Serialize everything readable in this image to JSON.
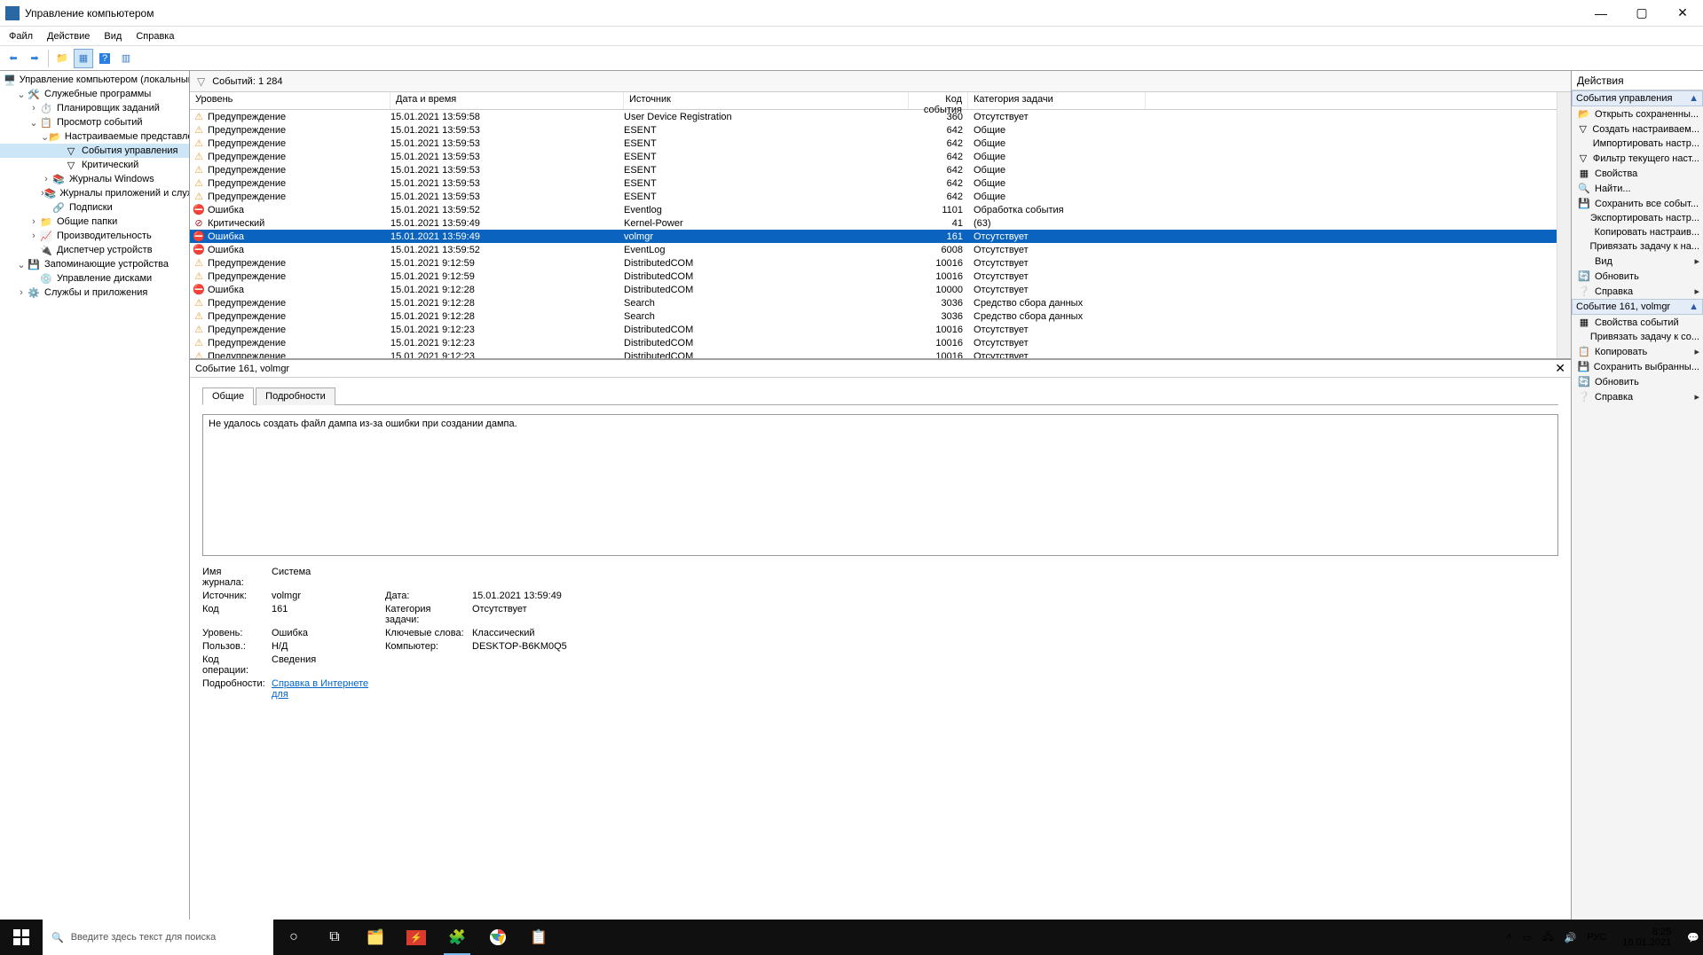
{
  "window": {
    "title": "Управление компьютером"
  },
  "menu": [
    "Файл",
    "Действие",
    "Вид",
    "Справка"
  ],
  "tree": [
    {
      "d": 0,
      "tw": "",
      "icon": "pc",
      "label": "Управление компьютером (локальным)"
    },
    {
      "d": 1,
      "tw": "v",
      "icon": "wrench",
      "label": "Служебные программы"
    },
    {
      "d": 2,
      "tw": ">",
      "icon": "clock",
      "label": "Планировщик заданий"
    },
    {
      "d": 2,
      "tw": "v",
      "icon": "log",
      "label": "Просмотр событий"
    },
    {
      "d": 3,
      "tw": "v",
      "icon": "folder",
      "label": "Настраиваемые представления"
    },
    {
      "d": 4,
      "tw": "",
      "icon": "filter",
      "label": "События управления",
      "sel": true
    },
    {
      "d": 4,
      "tw": "",
      "icon": "filter",
      "label": "Критический"
    },
    {
      "d": 3,
      "tw": ">",
      "icon": "logs",
      "label": "Журналы Windows"
    },
    {
      "d": 3,
      "tw": ">",
      "icon": "logs",
      "label": "Журналы приложений и служб"
    },
    {
      "d": 3,
      "tw": "",
      "icon": "sub",
      "label": "Подписки"
    },
    {
      "d": 2,
      "tw": ">",
      "icon": "share",
      "label": "Общие папки"
    },
    {
      "d": 2,
      "tw": ">",
      "icon": "perf",
      "label": "Производительность"
    },
    {
      "d": 2,
      "tw": "",
      "icon": "dev",
      "label": "Диспетчер устройств"
    },
    {
      "d": 1,
      "tw": "v",
      "icon": "storage",
      "label": "Запоминающие устройства"
    },
    {
      "d": 2,
      "tw": "",
      "icon": "disk",
      "label": "Управление дисками"
    },
    {
      "d": 1,
      "tw": ">",
      "icon": "gear",
      "label": "Службы и приложения"
    }
  ],
  "eventCount": "Событий: 1 284",
  "gridHeaders": {
    "level": "Уровень",
    "date": "Дата и время",
    "src": "Источник",
    "code": "Код события",
    "cat": "Категория задачи"
  },
  "rows": [
    {
      "t": "warn",
      "level": "Предупреждение",
      "date": "15.01.2021 13:59:58",
      "src": "User Device Registration",
      "code": "360",
      "cat": "Отсутствует"
    },
    {
      "t": "warn",
      "level": "Предупреждение",
      "date": "15.01.2021 13:59:53",
      "src": "ESENT",
      "code": "642",
      "cat": "Общие"
    },
    {
      "t": "warn",
      "level": "Предупреждение",
      "date": "15.01.2021 13:59:53",
      "src": "ESENT",
      "code": "642",
      "cat": "Общие"
    },
    {
      "t": "warn",
      "level": "Предупреждение",
      "date": "15.01.2021 13:59:53",
      "src": "ESENT",
      "code": "642",
      "cat": "Общие"
    },
    {
      "t": "warn",
      "level": "Предупреждение",
      "date": "15.01.2021 13:59:53",
      "src": "ESENT",
      "code": "642",
      "cat": "Общие"
    },
    {
      "t": "warn",
      "level": "Предупреждение",
      "date": "15.01.2021 13:59:53",
      "src": "ESENT",
      "code": "642",
      "cat": "Общие"
    },
    {
      "t": "warn",
      "level": "Предупреждение",
      "date": "15.01.2021 13:59:53",
      "src": "ESENT",
      "code": "642",
      "cat": "Общие"
    },
    {
      "t": "err",
      "level": "Ошибка",
      "date": "15.01.2021 13:59:52",
      "src": "Eventlog",
      "code": "1101",
      "cat": "Обработка события"
    },
    {
      "t": "crit",
      "level": "Критический",
      "date": "15.01.2021 13:59:49",
      "src": "Kernel-Power",
      "code": "41",
      "cat": "(63)"
    },
    {
      "t": "err",
      "level": "Ошибка",
      "date": "15.01.2021 13:59:49",
      "src": "volmgr",
      "code": "161",
      "cat": "Отсутствует",
      "sel": true
    },
    {
      "t": "err",
      "level": "Ошибка",
      "date": "15.01.2021 13:59:52",
      "src": "EventLog",
      "code": "6008",
      "cat": "Отсутствует"
    },
    {
      "t": "warn",
      "level": "Предупреждение",
      "date": "15.01.2021 9:12:59",
      "src": "DistributedCOM",
      "code": "10016",
      "cat": "Отсутствует"
    },
    {
      "t": "warn",
      "level": "Предупреждение",
      "date": "15.01.2021 9:12:59",
      "src": "DistributedCOM",
      "code": "10016",
      "cat": "Отсутствует"
    },
    {
      "t": "err",
      "level": "Ошибка",
      "date": "15.01.2021 9:12:28",
      "src": "DistributedCOM",
      "code": "10000",
      "cat": "Отсутствует"
    },
    {
      "t": "warn",
      "level": "Предупреждение",
      "date": "15.01.2021 9:12:28",
      "src": "Search",
      "code": "3036",
      "cat": "Средство сбора данных"
    },
    {
      "t": "warn",
      "level": "Предупреждение",
      "date": "15.01.2021 9:12:28",
      "src": "Search",
      "code": "3036",
      "cat": "Средство сбора данных"
    },
    {
      "t": "warn",
      "level": "Предупреждение",
      "date": "15.01.2021 9:12:23",
      "src": "DistributedCOM",
      "code": "10016",
      "cat": "Отсутствует"
    },
    {
      "t": "warn",
      "level": "Предупреждение",
      "date": "15.01.2021 9:12:23",
      "src": "DistributedCOM",
      "code": "10016",
      "cat": "Отсутствует"
    },
    {
      "t": "warn",
      "level": "Предупреждение",
      "date": "15.01.2021 9:12:23",
      "src": "DistributedCOM",
      "code": "10016",
      "cat": "Отсутствует"
    }
  ],
  "detail": {
    "title": "Событие 161, volmgr",
    "tabs": [
      "Общие",
      "Подробности"
    ],
    "message": "Не удалось создать файл дампа из-за ошибки при создании дампа.",
    "meta": {
      "logNameL": "Имя журнала:",
      "logName": "Система",
      "srcL": "Источник:",
      "src": "volmgr",
      "dateL": "Дата:",
      "date": "15.01.2021 13:59:49",
      "codeL": "Код",
      "code": "161",
      "catL": "Категория задачи:",
      "cat": "Отсутствует",
      "lvlL": "Уровень:",
      "lvl": "Ошибка",
      "kwL": "Ключевые слова:",
      "kw": "Классический",
      "userL": "Пользов.:",
      "user": "Н/Д",
      "compL": "Компьютер:",
      "comp": "DESKTOP-B6KM0Q5",
      "opL": "Код операции:",
      "op": "Сведения",
      "moreL": "Подробности:",
      "moreLink": "Справка в Интернете для "
    }
  },
  "actions": {
    "title": "Действия",
    "sec1": "События управления",
    "items1": [
      {
        "i": "open",
        "l": "Открыть сохраненны..."
      },
      {
        "i": "filter",
        "l": "Создать настраиваем..."
      },
      {
        "i": "",
        "l": "Импортировать настр..."
      },
      {
        "i": "filter",
        "l": "Фильтр текущего наст..."
      },
      {
        "i": "prop",
        "l": "Свойства"
      },
      {
        "i": "find",
        "l": "Найти..."
      },
      {
        "i": "save",
        "l": "Сохранить все событ..."
      },
      {
        "i": "",
        "l": "Экспортировать настр..."
      },
      {
        "i": "",
        "l": "Копировать настраив..."
      },
      {
        "i": "",
        "l": "Привязать задачу к на..."
      },
      {
        "i": "",
        "l": "Вид",
        "arr": true
      },
      {
        "i": "refresh",
        "l": "Обновить"
      },
      {
        "i": "help",
        "l": "Справка",
        "arr": true
      }
    ],
    "sec2": "Событие 161, volmgr",
    "items2": [
      {
        "i": "prop",
        "l": "Свойства событий"
      },
      {
        "i": "",
        "l": "Привязать задачу к со..."
      },
      {
        "i": "copy",
        "l": "Копировать",
        "arr": true
      },
      {
        "i": "save",
        "l": "Сохранить выбранны..."
      },
      {
        "i": "refresh",
        "l": "Обновить"
      },
      {
        "i": "help",
        "l": "Справка",
        "arr": true
      }
    ]
  },
  "taskbar": {
    "searchPlaceholder": "Введите здесь текст для поиска",
    "lang": "РУС",
    "time": "8:25",
    "date": "16.01.2021"
  }
}
